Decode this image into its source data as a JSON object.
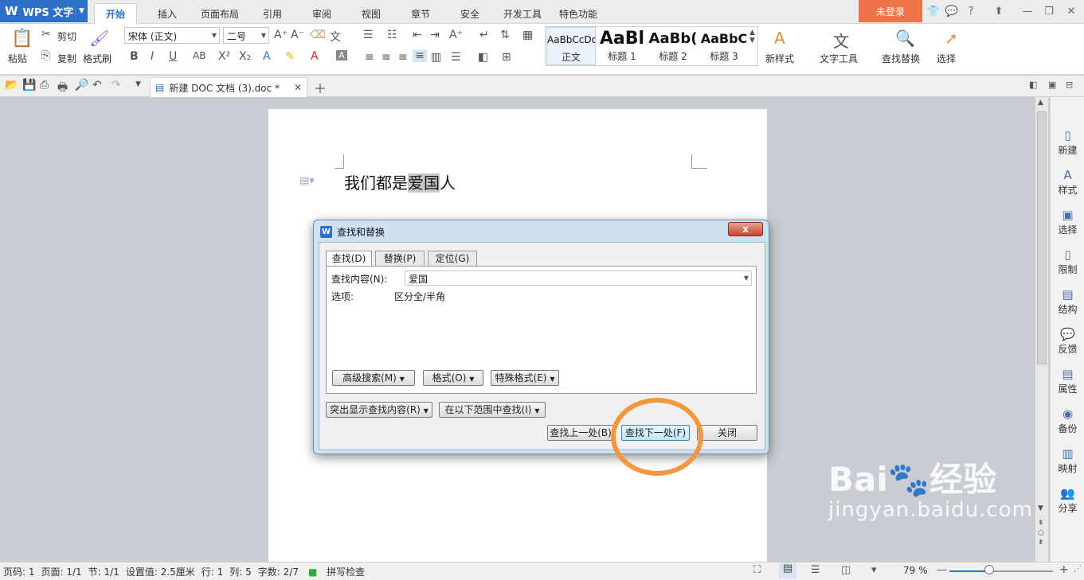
{
  "app": {
    "title": "WPS 文字",
    "login": "未登录"
  },
  "menu_tabs": [
    "开始",
    "插入",
    "页面布局",
    "引用",
    "审阅",
    "视图",
    "章节",
    "安全",
    "开发工具",
    "特色功能"
  ],
  "ribbon": {
    "paste": "粘贴",
    "cut": "剪切",
    "copy": "复制",
    "format_painter": "格式刷",
    "font_name": "宋体 (正文)",
    "font_size": "二号",
    "styles": [
      {
        "sample": "AaBbCcDd",
        "name": "正文"
      },
      {
        "sample": "AaBl",
        "name": "标题 1"
      },
      {
        "sample": "AaBb(",
        "name": "标题 2"
      },
      {
        "sample": "AaBbC",
        "name": "标题 3"
      }
    ],
    "new_style": "新样式",
    "text_tools": "文字工具",
    "find_replace": "查找替换",
    "select": "选择"
  },
  "doc_tab": "新建 DOC 文档 (3).doc *",
  "document": {
    "before": "我们都是",
    "highlight": "爱国",
    "after": "人"
  },
  "sidebar": [
    "新建",
    "样式",
    "选择",
    "限制",
    "结构",
    "反馈",
    "属性",
    "备份",
    "映射",
    "分享"
  ],
  "dialog": {
    "title": "查找和替换",
    "close": "x",
    "tabs": [
      "查找(D)",
      "替换(P)",
      "定位(G)"
    ],
    "find_label": "查找内容(N):",
    "find_value": "爱国",
    "options_label": "选项:",
    "options_value": "区分全/半角",
    "advanced": "高级搜索(M)",
    "format": "格式(O)",
    "special": "特殊格式(E)",
    "highlight_all": "突出显示查找内容(R)",
    "find_in": "在以下范围中查找(I)",
    "find_prev": "查找上一处(B)",
    "find_next": "查找下一处(F)",
    "close_btn": "关闭"
  },
  "status": {
    "page_code": "页码: 1",
    "page": "页面: 1/1",
    "section": "节: 1/1",
    "setting": "设置值: 2.5厘米",
    "row": "行: 1",
    "col": "列: 5",
    "words": "字数: 2/7",
    "spell": "拼写检查",
    "zoom": "79 %"
  },
  "watermark": {
    "brand": "Bai",
    "brand2": "经验",
    "url": "jingyan.baidu.com"
  },
  "colors": {
    "accent": "#2d6fc9",
    "login_bg": "#ef7447",
    "highlight_circle": "#f29640"
  }
}
